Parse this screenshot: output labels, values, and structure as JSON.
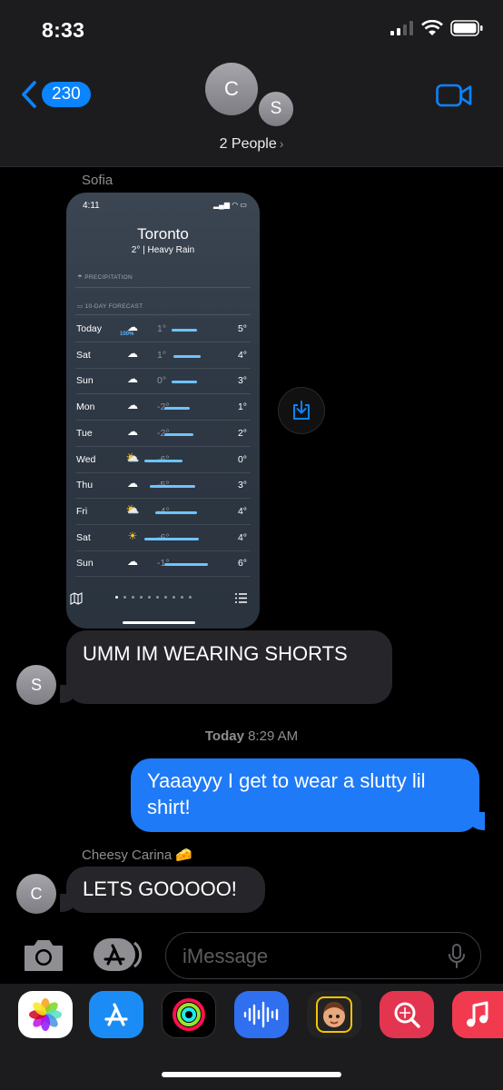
{
  "status_bar": {
    "time": "8:33"
  },
  "header": {
    "back_count": "230",
    "avatar_c": "C",
    "avatar_s": "S",
    "group_label": "2 People"
  },
  "messages": {
    "sofia_name": "Sofia",
    "screenshot": {
      "time": "4:11",
      "city": "Toronto",
      "condition": "2° | Heavy Rain",
      "precip_label": "PRECIPITATION",
      "forecast_label": "10-DAY FORECAST",
      "rows": [
        {
          "day": "Today",
          "icon": "☁",
          "pct": "100%",
          "lo": "1°",
          "hi": "5°"
        },
        {
          "day": "Sat",
          "icon": "☁",
          "pct": "",
          "lo": "1°",
          "hi": "4°"
        },
        {
          "day": "Sun",
          "icon": "☁",
          "pct": "",
          "lo": "0°",
          "hi": "3°"
        },
        {
          "day": "Mon",
          "icon": "☁",
          "pct": "",
          "lo": "-2°",
          "hi": "1°"
        },
        {
          "day": "Tue",
          "icon": "☁",
          "pct": "",
          "lo": "-2°",
          "hi": "2°"
        },
        {
          "day": "Wed",
          "icon": "⛅",
          "pct": "",
          "lo": "-6°",
          "hi": "0°"
        },
        {
          "day": "Thu",
          "icon": "☁",
          "pct": "",
          "lo": "-5°",
          "hi": "3°"
        },
        {
          "day": "Fri",
          "icon": "⛅",
          "pct": "",
          "lo": "-4°",
          "hi": "4°"
        },
        {
          "day": "Sat",
          "icon": "☀",
          "pct": "",
          "lo": "-6°",
          "hi": "4°"
        },
        {
          "day": "Sun",
          "icon": "☁",
          "pct": "",
          "lo": "-1°",
          "hi": "6°"
        }
      ]
    },
    "sofia_text": "UMM IM WEARING SHORTS",
    "sofia_avatar": "S",
    "timestamp_day": "Today",
    "timestamp_time": "8:29 AM",
    "outgoing_text": "Yaaayyy I get to wear a slutty lil shirt!",
    "carina_name": "Cheesy Carina 🧀",
    "carina_text": "LETS GOOOOO!",
    "carina_avatar": "C"
  },
  "composer": {
    "placeholder": "iMessage"
  },
  "icons": [
    "signal-icon",
    "wifi-icon",
    "battery-icon",
    "back-chevron-icon",
    "video-call-icon",
    "save-icon",
    "camera-icon",
    "app-store-icon",
    "microphone-icon",
    "photos-app-icon",
    "activity-app-icon",
    "audio-message-icon",
    "memoji-icon",
    "search-images-icon",
    "music-app-icon"
  ],
  "colors": {
    "accent": "#0a84ff",
    "outgoing_bubble": "#1f7af8",
    "incoming_bubble": "#26252a"
  }
}
